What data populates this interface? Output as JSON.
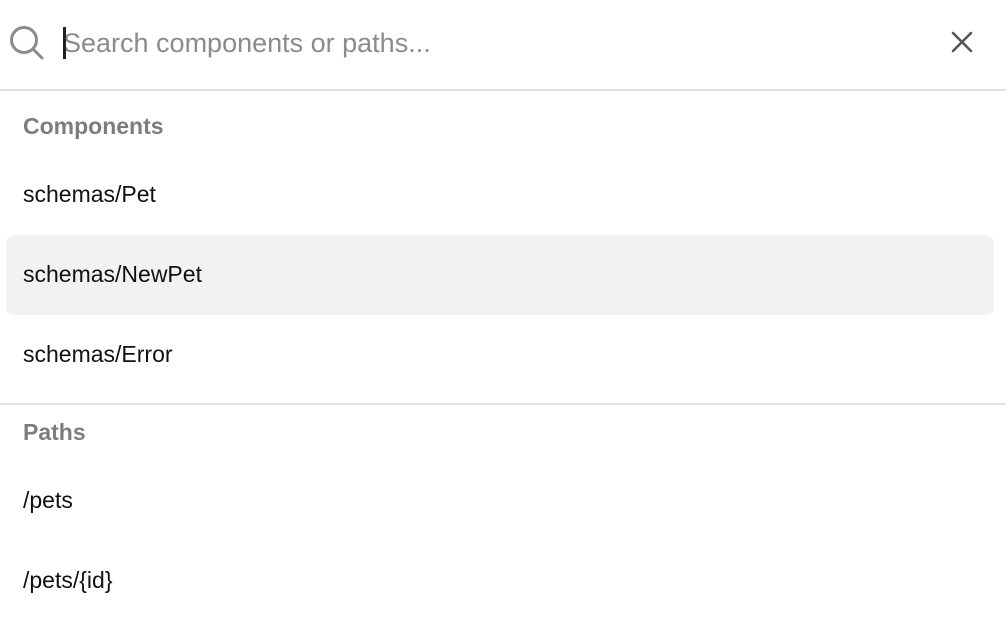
{
  "search": {
    "placeholder": "Search components or paths...",
    "value": ""
  },
  "icons": {
    "search": "search-icon",
    "close": "close-icon"
  },
  "sections": {
    "components": {
      "header": "Components",
      "items": [
        "schemas/Pet",
        "schemas/NewPet",
        "schemas/Error"
      ],
      "selected_index": 1
    },
    "paths": {
      "header": "Paths",
      "items": [
        "/pets",
        "/pets/{id}"
      ]
    }
  },
  "colors": {
    "selected_bg": "#f2f2f3",
    "divider": "#e2e2e4",
    "header_text": "#7c7c84",
    "item_text": "#111111"
  }
}
